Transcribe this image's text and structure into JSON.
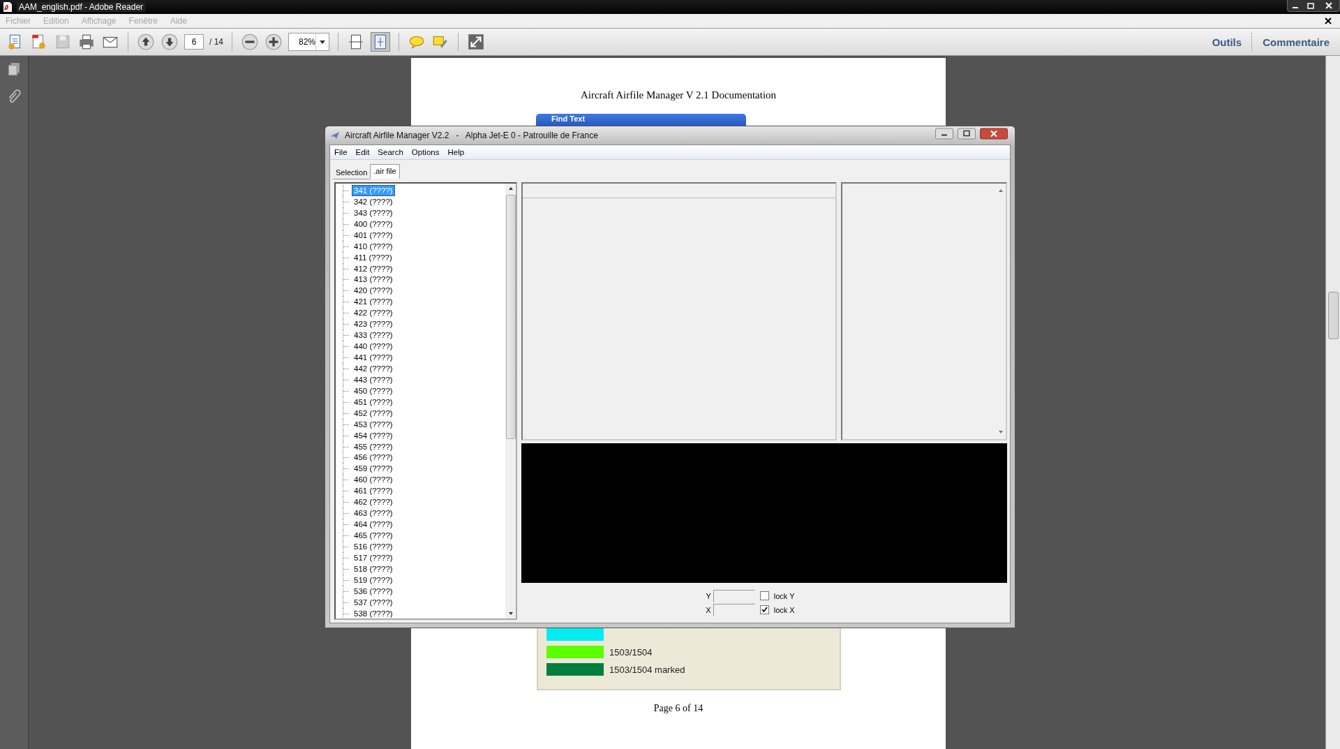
{
  "window": {
    "title": "AAM_english.pdf - Adobe Reader"
  },
  "menu": [
    "Fichier",
    "Edition",
    "Affichage",
    "Fenêtre",
    "Aide"
  ],
  "toolbar": {
    "page": "6",
    "page_count": "/ 14",
    "zoom": "82%",
    "links": [
      "Outils",
      "Commentaire"
    ]
  },
  "document": {
    "heading": "Aircraft Airfile Manager V 2.1 Documentation",
    "footer": "Page 6 of 14",
    "legend": [
      {
        "color": "#00eef0"
      },
      {
        "color": "#5cff00",
        "label": "1503/1504"
      },
      {
        "color": "#007f3f",
        "label": "1503/1504 marked"
      }
    ]
  },
  "find_dialog": {
    "title": "Find Text"
  },
  "embedded_app": {
    "title": "Aircraft Airfile Manager V2.2   -   Alpha Jet-E 0 - Patrouille de France",
    "menu": [
      "File",
      "Edit",
      "Search",
      "Options",
      "Help"
    ],
    "tabs": [
      {
        "label": "Selection",
        "selected": false
      },
      {
        "label": ".air file",
        "selected": true
      }
    ],
    "tree": [
      {
        "label": "341 (????)",
        "selected": true
      },
      {
        "label": "342 (????)",
        "selected": false
      },
      {
        "label": "343 (????)",
        "selected": false
      },
      {
        "label": "400 (????)",
        "selected": false
      },
      {
        "label": "401 (????)",
        "selected": false
      },
      {
        "label": "410 (????)",
        "selected": false
      },
      {
        "label": "411 (????)",
        "selected": false
      },
      {
        "label": "412 (????)",
        "selected": false
      },
      {
        "label": "413 (????)",
        "selected": false
      },
      {
        "label": "420 (????)",
        "selected": false
      },
      {
        "label": "421 (????)",
        "selected": false
      },
      {
        "label": "422 (????)",
        "selected": false
      },
      {
        "label": "423 (????)",
        "selected": false
      },
      {
        "label": "433 (????)",
        "selected": false
      },
      {
        "label": "440 (????)",
        "selected": false
      },
      {
        "label": "441 (????)",
        "selected": false
      },
      {
        "label": "442 (????)",
        "selected": false
      },
      {
        "label": "443 (????)",
        "selected": false
      },
      {
        "label": "450 (????)",
        "selected": false
      },
      {
        "label": "451 (????)",
        "selected": false
      },
      {
        "label": "452 (????)",
        "selected": false
      },
      {
        "label": "453 (????)",
        "selected": false
      },
      {
        "label": "454 (????)",
        "selected": false
      },
      {
        "label": "455 (????)",
        "selected": false
      },
      {
        "label": "456 (????)",
        "selected": false
      },
      {
        "label": "459 (????)",
        "selected": false
      },
      {
        "label": "460 (????)",
        "selected": false
      },
      {
        "label": "461 (????)",
        "selected": false
      },
      {
        "label": "462 (????)",
        "selected": false
      },
      {
        "label": "463 (????)",
        "selected": false
      },
      {
        "label": "464 (????)",
        "selected": false
      },
      {
        "label": "465 (????)",
        "selected": false
      },
      {
        "label": "516 (????)",
        "selected": false
      },
      {
        "label": "517 (????)",
        "selected": false
      },
      {
        "label": "518 (????)",
        "selected": false
      },
      {
        "label": "519 (????)",
        "selected": false
      },
      {
        "label": "536 (????)",
        "selected": false
      },
      {
        "label": "537 (????)",
        "selected": false
      },
      {
        "label": "538 (????)",
        "selected": false
      }
    ],
    "coords": [
      {
        "axis": "Y",
        "lock_label": "lock Y",
        "checked": false
      },
      {
        "axis": "X",
        "lock_label": "lock X",
        "checked": true
      }
    ]
  }
}
